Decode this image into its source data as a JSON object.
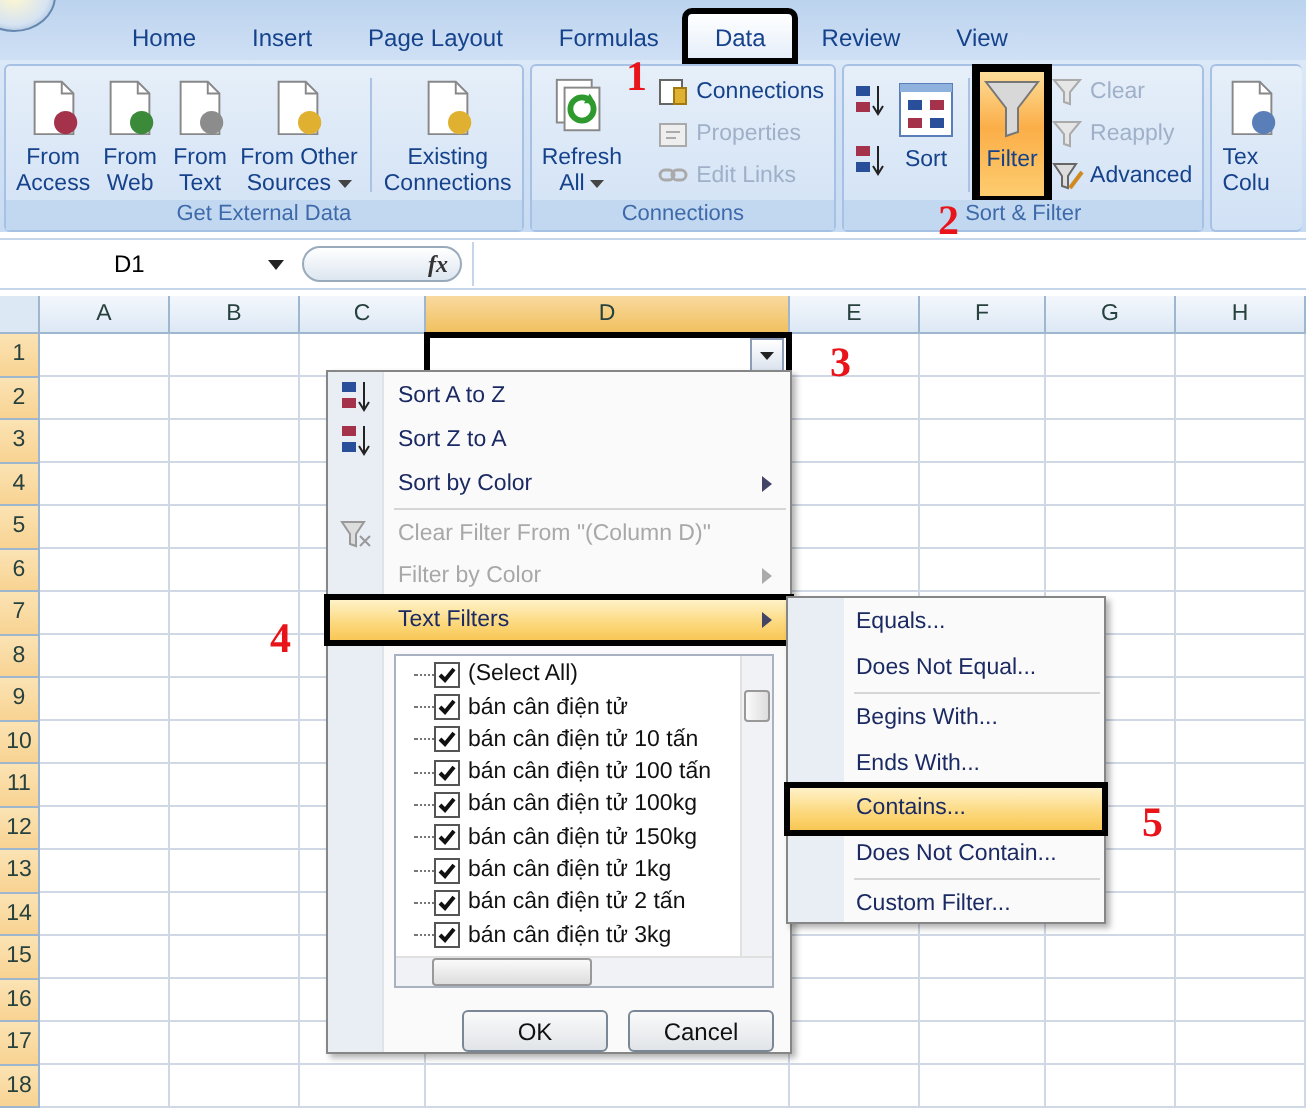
{
  "ribbon": {
    "tabs": [
      {
        "label": "Home",
        "selected": false,
        "boxed": false
      },
      {
        "label": "Insert",
        "selected": false,
        "boxed": false
      },
      {
        "label": "Page Layout",
        "selected": false,
        "boxed": false
      },
      {
        "label": "Formulas",
        "selected": false,
        "boxed": false
      },
      {
        "label": "Data",
        "selected": true,
        "boxed": true
      },
      {
        "label": "Review",
        "selected": false,
        "boxed": false
      },
      {
        "label": "View",
        "selected": false,
        "boxed": false
      }
    ],
    "groups": [
      {
        "name": "Get External Data",
        "columns": [
          {
            "buttons": [
              {
                "kind": "access",
                "label": "From\nAccess"
              }
            ]
          },
          {
            "buttons": [
              {
                "kind": "web",
                "label": "From\nWeb"
              }
            ]
          },
          {
            "buttons": [
              {
                "kind": "text",
                "label": "From\nText"
              }
            ]
          },
          {
            "buttons": [
              {
                "kind": "other",
                "label": "From Other\nSources",
                "dropdown": true
              }
            ]
          },
          {
            "kind": "divider"
          },
          {
            "buttons": [
              {
                "kind": "existing",
                "label": "Existing\nConnections"
              }
            ]
          }
        ]
      },
      {
        "name": "Connections",
        "columns": [
          {
            "buttons": [
              {
                "kind": "refresh",
                "label": "Refresh\nAll",
                "dropdown": true
              }
            ]
          },
          {
            "buttons": [
              {
                "kind": "connections",
                "label": "Connections",
                "disabled": false
              },
              {
                "kind": "properties",
                "label": "Properties",
                "disabled": true
              },
              {
                "kind": "edit-links",
                "label": "Edit Links",
                "disabled": true
              }
            ]
          }
        ]
      },
      {
        "name": "Sort & Filter",
        "columns": [
          {
            "buttons": [
              {
                "kind": "sort-asc"
              },
              {
                "kind": "sort-desc"
              }
            ]
          },
          {
            "buttons": [
              {
                "kind": "sort",
                "label": "Sort"
              }
            ]
          },
          {
            "kind": "divider"
          },
          {
            "buttons": [
              {
                "kind": "filter",
                "label": "Filter",
                "selected": true,
                "boxed": true
              }
            ]
          },
          {
            "buttons": [
              {
                "kind": "clear",
                "label": "Clear",
                "disabled": true
              },
              {
                "kind": "reapply",
                "label": "Reapply",
                "disabled": true
              },
              {
                "kind": "advanced",
                "label": "Advanced",
                "disabled": false
              }
            ]
          }
        ]
      },
      {
        "columns": [
          {
            "buttons": [
              {
                "kind": "text-columns",
                "label": "Tex\nColu"
              }
            ]
          }
        ]
      }
    ]
  },
  "formula_bar": {
    "name_box": "D1",
    "function_label": "fx"
  },
  "sheet": {
    "columns": [
      {
        "label": "A",
        "selected": false
      },
      {
        "label": "B",
        "selected": false
      },
      {
        "label": "C",
        "selected": false
      },
      {
        "label": "D",
        "selected": true
      },
      {
        "label": "E",
        "selected": false
      },
      {
        "label": "F",
        "selected": false
      },
      {
        "label": "G",
        "selected": false
      },
      {
        "label": "H",
        "selected": false
      }
    ],
    "rows": [
      "1",
      "2",
      "3",
      "4",
      "5",
      "6",
      "7",
      "8",
      "9",
      "10",
      "11",
      "12",
      "13",
      "14",
      "15",
      "16",
      "17",
      "18"
    ],
    "filter_cell_boxed": true
  },
  "filter_menu": {
    "items": [
      {
        "kind": "sort-asc",
        "label": "Sort A to Z",
        "disabled": false,
        "submenu": false,
        "selected": false,
        "boxed": false
      },
      {
        "kind": "sort-desc",
        "label": "Sort Z to A",
        "disabled": false,
        "submenu": false,
        "selected": false,
        "boxed": false
      },
      {
        "kind": "plain",
        "label": "Sort by Color",
        "disabled": false,
        "submenu": true,
        "selected": false,
        "boxed": false
      },
      {
        "kind": "separator"
      },
      {
        "kind": "clear",
        "label": "Clear Filter From \"(Column D)\"",
        "disabled": true,
        "submenu": false,
        "selected": false,
        "boxed": false
      },
      {
        "kind": "plain",
        "label": "Filter by Color",
        "disabled": true,
        "submenu": true,
        "selected": false,
        "boxed": false
      },
      {
        "kind": "plain",
        "label": "Text Filters",
        "disabled": false,
        "submenu": true,
        "selected": true,
        "boxed": true
      }
    ],
    "values": [
      {
        "label": "(Select All)",
        "checked": true
      },
      {
        "label": "bán cân điện tử",
        "checked": true
      },
      {
        "label": "bán cân điện tử 10 tấn",
        "checked": true
      },
      {
        "label": "bán cân điện tử 100 tấn",
        "checked": true
      },
      {
        "label": "bán cân điện tử 100kg",
        "checked": true
      },
      {
        "label": "bán cân điện tử 150kg",
        "checked": true
      },
      {
        "label": "bán cân điện tử 1kg",
        "checked": true
      },
      {
        "label": "bán cân điện tử 2 tấn",
        "checked": true
      },
      {
        "label": "bán cân điện tử 3kg",
        "checked": true
      }
    ],
    "buttons": [
      "OK",
      "Cancel"
    ]
  },
  "text_filters_menu": {
    "items": [
      {
        "kind": "item",
        "label": "Equals...",
        "selected": false,
        "boxed": false
      },
      {
        "kind": "item",
        "label": "Does Not Equal...",
        "selected": false,
        "boxed": false
      },
      {
        "kind": "separator"
      },
      {
        "kind": "item",
        "label": "Begins With...",
        "selected": false,
        "boxed": false
      },
      {
        "kind": "item",
        "label": "Ends With...",
        "selected": false,
        "boxed": false
      },
      {
        "kind": "item",
        "label": "Contains...",
        "selected": true,
        "boxed": true
      },
      {
        "kind": "item",
        "label": "Does Not Contain...",
        "selected": false,
        "boxed": false
      },
      {
        "kind": "separator"
      },
      {
        "kind": "item",
        "label": "Custom Filter...",
        "selected": false,
        "boxed": false
      }
    ]
  },
  "step_numbers": [
    "1",
    "2",
    "3",
    "4",
    "5"
  ]
}
